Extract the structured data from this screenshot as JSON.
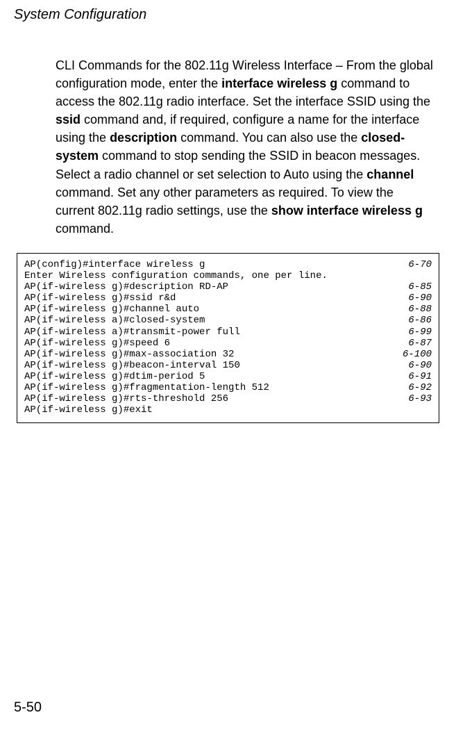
{
  "header": "System Configuration",
  "paragraph": {
    "t1": "CLI Commands for the 802.11g Wireless Interface – From the global configuration mode, enter the ",
    "b1": "interface wireless g",
    "t2": " command to access the 802.11g radio interface. Set the interface SSID using the ",
    "b2": "ssid",
    "t3": " command and, if required, configure a name for the interface using the ",
    "b3": "description",
    "t4": " command. You can also use the ",
    "b4": "closed-system",
    "t5": " command to stop sending the SSID in beacon messages. Select a radio channel or set selection to Auto using the ",
    "b5": "channel",
    "t6": " command. Set any other parameters as required. To view the current 802.11g radio settings, use the ",
    "b6": "show interface wireless g",
    "t7": " command."
  },
  "code": [
    {
      "cmd": "AP(config)#interface wireless g",
      "ref": "6-70"
    },
    {
      "cmd": "Enter Wireless configuration commands, one per line.",
      "ref": ""
    },
    {
      "cmd": "AP(if-wireless g)#description RD-AP",
      "ref": "6-85"
    },
    {
      "cmd": "AP(if-wireless g)#ssid r&d",
      "ref": "6-90"
    },
    {
      "cmd": "AP(if-wireless g)#channel auto",
      "ref": "6-88"
    },
    {
      "cmd": "AP(if-wireless a)#closed-system",
      "ref": "6-86"
    },
    {
      "cmd": "AP(if-wireless a)#transmit-power full",
      "ref": "6-99"
    },
    {
      "cmd": "AP(if-wireless g)#speed 6",
      "ref": "6-87"
    },
    {
      "cmd": "AP(if-wireless g)#max-association 32",
      "ref": "6-100"
    },
    {
      "cmd": "AP(if-wireless g)#beacon-interval 150",
      "ref": "6-90"
    },
    {
      "cmd": "AP(if-wireless g)#dtim-period 5",
      "ref": "6-91"
    },
    {
      "cmd": "AP(if-wireless g)#fragmentation-length 512",
      "ref": "6-92"
    },
    {
      "cmd": "AP(if-wireless g)#rts-threshold 256",
      "ref": "6-93"
    },
    {
      "cmd": "AP(if-wireless g)#exit",
      "ref": ""
    }
  ],
  "page_number": "5-50"
}
